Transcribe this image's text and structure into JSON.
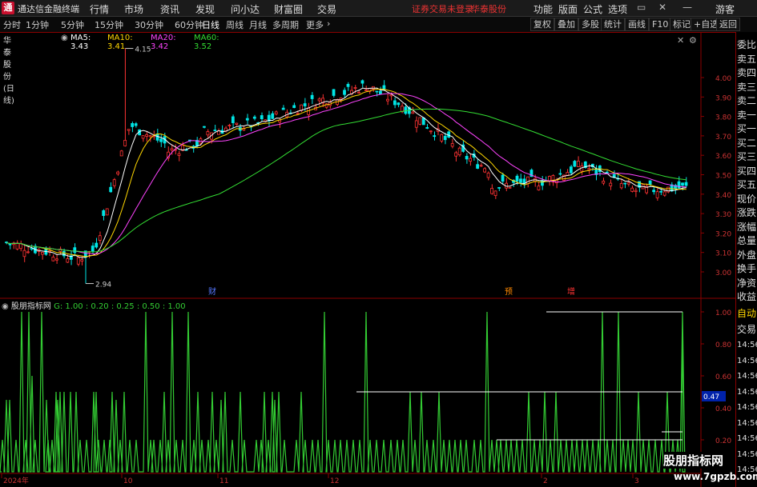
{
  "titlebar": {
    "app_name": "通达信金融终端",
    "menus": [
      "行情",
      "市场",
      "资讯",
      "发现",
      "问小达",
      "财富圈",
      "交易"
    ],
    "notice": "证券交易未登录",
    "broker": "华泰股份",
    "right_menus": [
      "功能",
      "版面",
      "公式",
      "选项"
    ],
    "guest": "游客"
  },
  "toolbar": {
    "periods": [
      "分时",
      "1分钟",
      "5分钟",
      "15分钟",
      "30分钟",
      "60分钟",
      "日线",
      "周线",
      "月线",
      "多周期",
      "更多"
    ],
    "active_period": "日线",
    "buttons": [
      "复权",
      "叠加",
      "多股",
      "统计",
      "画线",
      "F10",
      "标记",
      "+自选",
      "返回"
    ]
  },
  "stock": {
    "name": "华泰股份(日线)",
    "ma5": "MA5: 3.43",
    "ma10": "MA10: 3.41",
    "ma20": "MA20: 3.42",
    "ma60": "MA60: 3.52"
  },
  "price_axis": {
    "labels": [
      "4.00",
      "3.90",
      "3.80",
      "3.70",
      "3.60",
      "3.50",
      "3.40",
      "3.30",
      "3.20",
      "3.10",
      "3.00"
    ],
    "high_label": "4.15",
    "low_label": "2.94"
  },
  "markers": {
    "cai": "财",
    "zeng": "增",
    "yu": "预"
  },
  "indicator": {
    "title": "股朋指标网",
    "params": "G: 1.00 : 0.20 : 0.25 : 0.50 : 1.00",
    "axis": [
      "1.00",
      "0.80",
      "0.60",
      "0.40",
      "0.20"
    ],
    "current": "0.47"
  },
  "time_axis": [
    "2024年",
    "10",
    "11",
    "12",
    "2",
    "3"
  ],
  "right_panel": [
    "委比",
    "卖五",
    "卖四",
    "卖三",
    "卖二",
    "卖一",
    "买一",
    "买二",
    "买三",
    "买四",
    "买五",
    "现价",
    "涨跌",
    "涨幅",
    "总量",
    "外盘",
    "换手",
    "净资",
    "收益"
  ],
  "right_panel_bottom": {
    "auto": "自动",
    "trade": "交易",
    "times": [
      "14:56",
      "14:56",
      "14:56",
      "14:56",
      "14:56",
      "14:56",
      "14:56",
      "14:56",
      "14:56"
    ]
  },
  "watermark": {
    "line1": "股朋指标网",
    "line2": "www.7gpzb.com"
  },
  "colors": {
    "up": "#ff3333",
    "down": "#00e5e5",
    "ma5": "#ffffff",
    "ma10": "#ffd700",
    "ma20": "#ff44ff",
    "ma60": "#33dd33",
    "indicator": "#33cc33"
  }
}
